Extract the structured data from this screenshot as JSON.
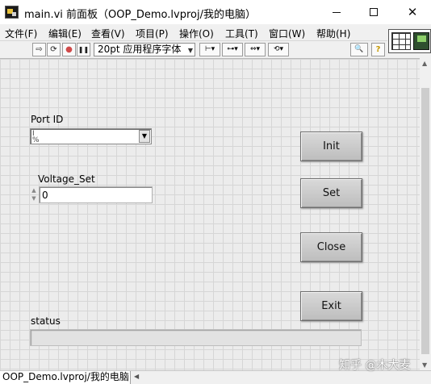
{
  "window": {
    "title": "main.vi 前面板（OOP_Demo.lvproj/我的电脑）",
    "minimize_glyph": "",
    "maximize_glyph": "",
    "close_glyph": "✕"
  },
  "menu": {
    "items": [
      "文件(F)",
      "编辑(E)",
      "查看(V)",
      "项目(P)",
      "操作(O)",
      "工具(T)",
      "窗口(W)",
      "帮助(H)"
    ]
  },
  "toolbar": {
    "run_glyph": "⇨",
    "run_continuous_glyph": "⟳",
    "abort_glyph": "●",
    "pause_glyph": "❚❚",
    "font_label": "20pt 应用程序字体",
    "align_glyph": "⊢▾",
    "distribute_glyph": "⊶▾",
    "resize_glyph": "⇔▾",
    "reorder_glyph": "⟲▾",
    "search_glyph": "🔍",
    "help_glyph": "?"
  },
  "controls": {
    "port_id": {
      "label": "Port ID",
      "value": ""
    },
    "voltage_set": {
      "label": "Voltage_Set",
      "value": "0"
    },
    "status": {
      "label": "status",
      "value": ""
    }
  },
  "buttons": {
    "init": "Init",
    "set": "Set",
    "close": "Close",
    "exit": "Exit"
  },
  "statusbar": {
    "project_path": "OOP_Demo.lvproj/我的电脑"
  },
  "watermark": "知乎 @木大麦",
  "colors": {
    "canvas_bg": "#ececec",
    "grid_line": "#d6d6d6",
    "button_face": "#cccccc"
  }
}
